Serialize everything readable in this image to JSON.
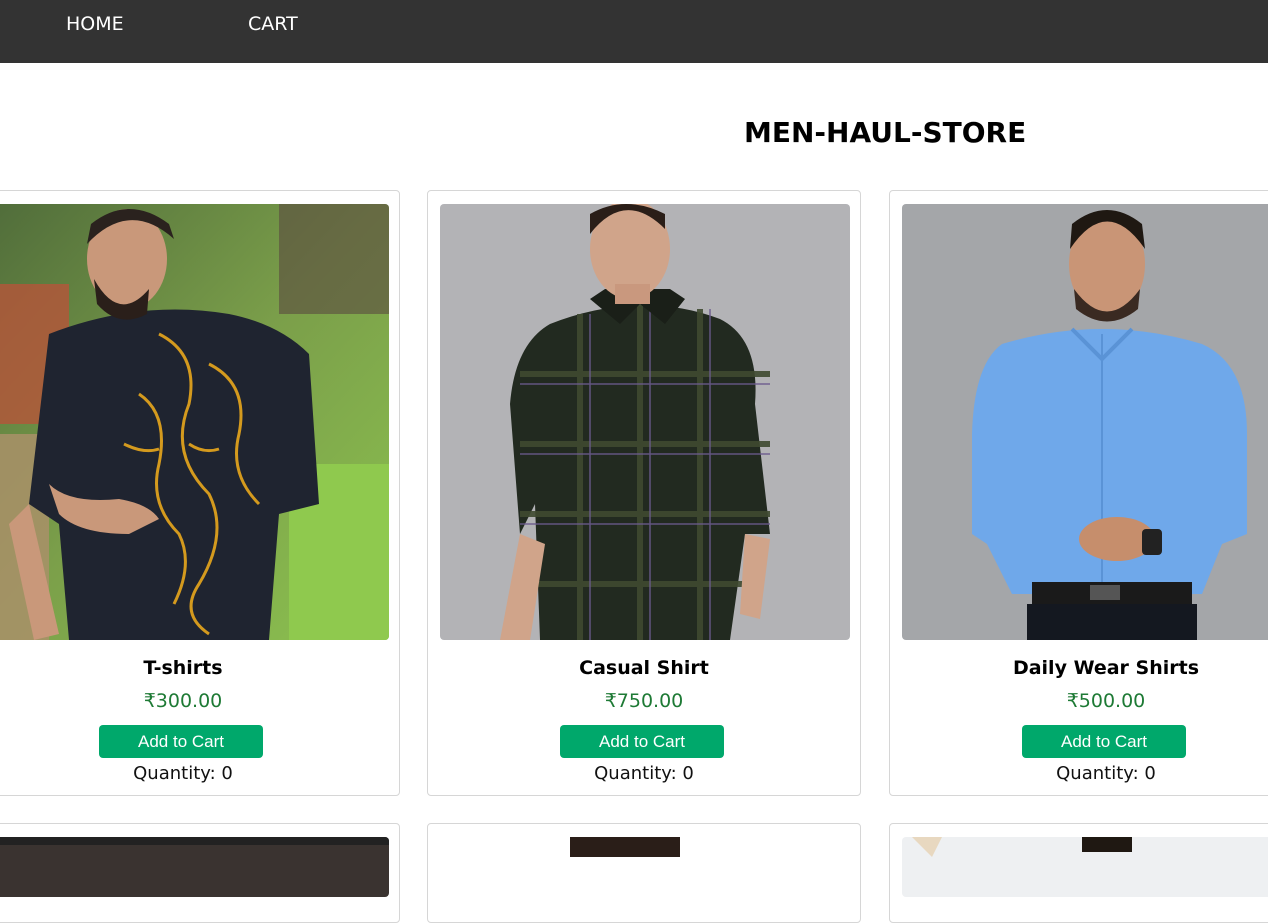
{
  "nav": {
    "home_label": "HOME",
    "cart_label": "CART"
  },
  "store": {
    "title": "MEN-HAUL-STORE"
  },
  "products": [
    {
      "name": "T-shirts",
      "price": "₹300.00",
      "button_label": "Add to Cart",
      "quantity_label": "Quantity:",
      "quantity": "0"
    },
    {
      "name": "Casual Shirt",
      "price": "₹750.00",
      "button_label": "Add to Cart",
      "quantity_label": "Quantity:",
      "quantity": "0"
    },
    {
      "name": "Daily Wear Shirts",
      "price": "₹500.00",
      "button_label": "Add to Cart",
      "quantity_label": "Quantity:",
      "quantity": "0"
    }
  ],
  "colors": {
    "nav_background": "#333333",
    "price": "#1e7a35",
    "button": "#00a86b"
  }
}
